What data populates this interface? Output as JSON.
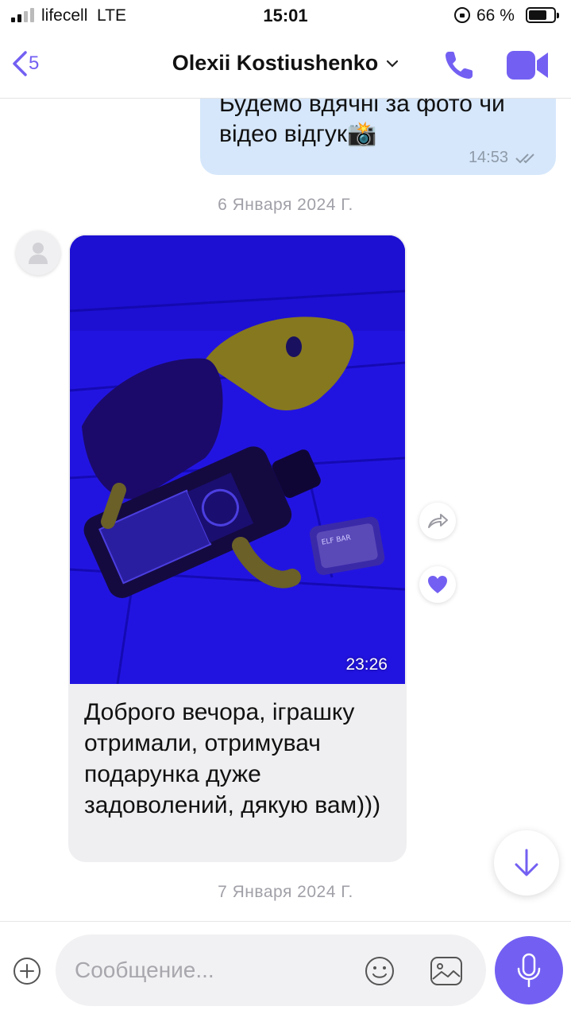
{
  "status_bar": {
    "carrier": "lifecell",
    "network": "LTE",
    "time": "15:01",
    "battery": "66 %",
    "battery_level": 0.66
  },
  "header": {
    "back_count": "5",
    "contact_name": "Olexii Kostiushenko",
    "accent_color": "#7360f2"
  },
  "messages": {
    "outgoing": {
      "text_line1": "Будемо вдячні за фото чи",
      "text_line2": "відео відгук📸",
      "time": "14:53"
    },
    "date_1": "6 Января 2024 Г.",
    "incoming": {
      "photo_time": "23:26",
      "text": "Доброго вечора, іграшку отримали, отримувач подарунка дуже задоволений, дякую вам)))"
    },
    "date_2": "7 Января 2024 Г."
  },
  "composer": {
    "placeholder": "Сообщение..."
  },
  "icons": {
    "back": "chevron-left-icon",
    "call": "phone-icon",
    "video": "video-camera-icon",
    "forward": "forward-icon",
    "like": "heart-icon",
    "scroll": "arrow-down-icon",
    "attach": "plus-circle-icon",
    "emoji": "smiley-icon",
    "sticker": "sticker-icon",
    "mic": "microphone-icon"
  }
}
